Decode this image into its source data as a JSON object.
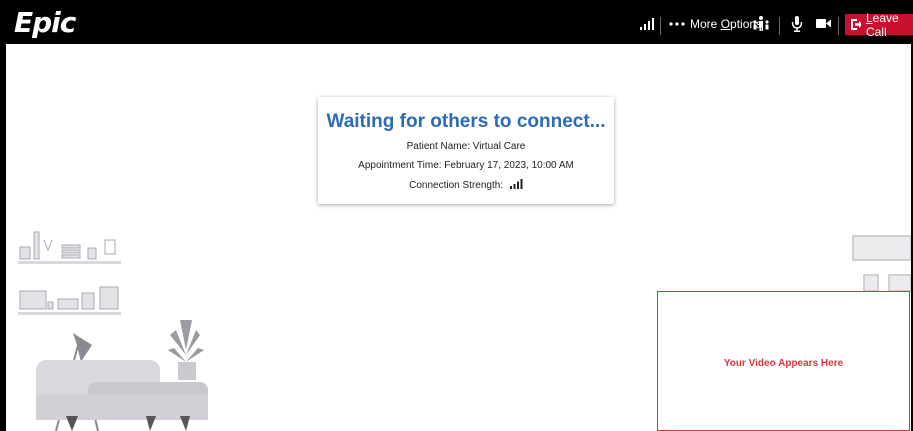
{
  "header": {
    "logo": "Epic",
    "more_options_prefix": "More ",
    "more_options_underlined": "O",
    "more_options_suffix": "ptions",
    "leave_call_underlined": "L",
    "leave_call_suffix": "eave Call"
  },
  "status": {
    "title": "Waiting for others to connect...",
    "patient_name": "Patient Name: Virtual Care",
    "appointment_time": "Appointment Time: February 17, 2023, 10:00 AM",
    "connection_strength_label": "Connection Strength:"
  },
  "video": {
    "placeholder": "Your Video Appears Here"
  },
  "colors": {
    "brand_title": "#2a6cb5",
    "leave_button": "#c8102e",
    "video_border": "#d9363e"
  }
}
